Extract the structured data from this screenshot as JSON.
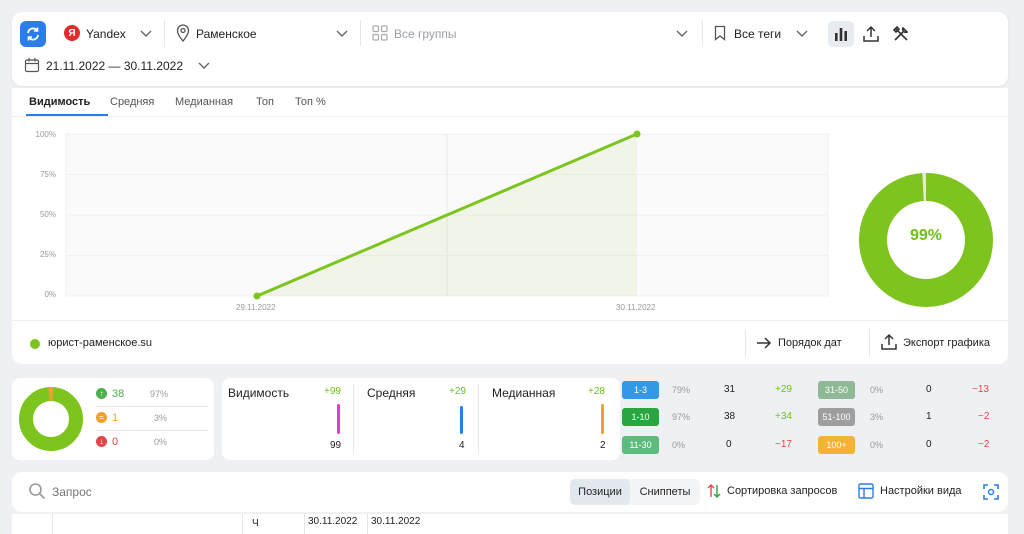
{
  "toolbar": {
    "engine": "Yandex",
    "engine_logo": "Я",
    "region": "Раменское",
    "groups_placeholder": "Все группы",
    "tags": "Все теги",
    "date_range": "21.11.2022 — 30.11.2022",
    "icons": [
      "sync-icon",
      "location-pin-icon",
      "grid-icon",
      "bookmark-icon",
      "bar-chart-icon",
      "upload-icon",
      "tools-icon",
      "calendar-icon"
    ]
  },
  "tabs": [
    {
      "label": "Видимость",
      "active": true
    },
    {
      "label": "Средняя",
      "active": false
    },
    {
      "label": "Медианная",
      "active": false
    },
    {
      "label": "Топ",
      "active": false
    },
    {
      "label": "Топ %",
      "active": false
    }
  ],
  "chart_data": {
    "type": "line",
    "x": [
      "29.11.2022",
      "30.11.2022"
    ],
    "series": [
      {
        "name": "юрист-раменское.su",
        "values": [
          0,
          100
        ],
        "color": "#7ec41e"
      }
    ],
    "y_ticks": [
      "0%",
      "25%",
      "50%",
      "75%",
      "100%"
    ],
    "ylim": [
      0,
      100
    ],
    "grid": true,
    "legend": "bottom-left"
  },
  "visibility_donut": {
    "value_label": "99%",
    "fraction": 0.99,
    "color": "#7ec41e"
  },
  "chart_footer": {
    "site": "юрист-раменское.su",
    "order_dates": "Порядок дат",
    "export_chart": "Экспорт графика"
  },
  "summary": {
    "up": {
      "count": "38",
      "pct": "97%"
    },
    "same": {
      "count": "1",
      "pct": "3%"
    },
    "down": {
      "count": "0",
      "pct": "0%"
    }
  },
  "metrics": [
    {
      "title": "Видимость",
      "delta": "+99",
      "value": "99",
      "color": "#e03ad8"
    },
    {
      "title": "Средняя",
      "delta": "+29",
      "value": "4",
      "color": "#2b7de9"
    },
    {
      "title": "Медианная",
      "delta": "+28",
      "value": "2",
      "color": "#f0a030"
    }
  ],
  "ranges_left": [
    {
      "label": "1-3",
      "pct": "79%",
      "count": "31",
      "delta": "+29",
      "color": "#3399e6"
    },
    {
      "label": "1-10",
      "pct": "97%",
      "count": "38",
      "delta": "+34",
      "color": "#2aa640"
    },
    {
      "label": "11-30",
      "pct": "0%",
      "count": "0",
      "delta": "−17",
      "color": "#5dbb7e"
    }
  ],
  "ranges_right": [
    {
      "label": "31-50",
      "pct": "0%",
      "count": "0",
      "delta": "−13",
      "color": "#8fb894"
    },
    {
      "label": "51-100",
      "pct": "3%",
      "count": "1",
      "delta": "−2",
      "color": "#9e9e9e"
    },
    {
      "label": "100+",
      "pct": "0%",
      "count": "0",
      "delta": "−2",
      "color": "#f5b335"
    }
  ],
  "search": {
    "placeholder": "Запрос",
    "positions": "Позиции",
    "snippets": "Сниппеты",
    "sort": "Сортировка запросов",
    "view_settings": "Настройки вида"
  },
  "table_header": {
    "col1": "Ч",
    "col2": "30.11.2022",
    "col3": "30.11.2022"
  }
}
